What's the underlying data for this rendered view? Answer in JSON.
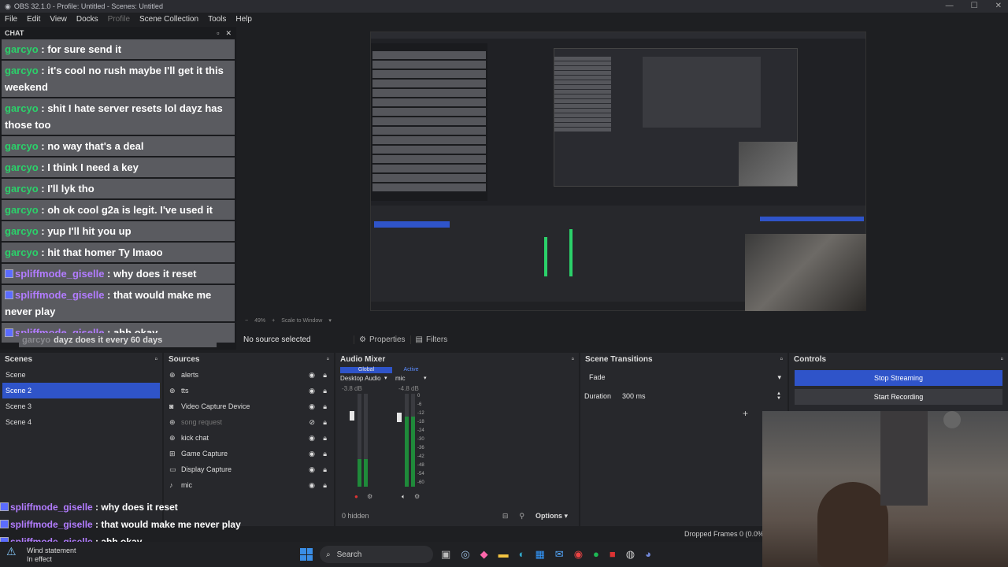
{
  "window": {
    "title": "OBS 32.1.0 - Profile: Untitled - Scenes: Untitled",
    "controls": [
      "—",
      "☐",
      "✕"
    ]
  },
  "menu": [
    "File",
    "Edit",
    "View",
    "Docks",
    "Profile",
    "Scene Collection",
    "Tools",
    "Help"
  ],
  "chat": {
    "title": "CHAT",
    "messages": [
      {
        "user": "garcyo",
        "text": "for sure send it",
        "badge": false
      },
      {
        "user": "garcyo",
        "text": "it's cool no rush maybe I'll get it this weekend",
        "badge": false
      },
      {
        "user": "garcyo",
        "text": "shit I hate server resets lol dayz has those too",
        "badge": false
      },
      {
        "user": "garcyo",
        "text": "no way that's a deal",
        "badge": false
      },
      {
        "user": "garcyo",
        "text": "I think I need a key",
        "badge": false
      },
      {
        "user": "garcyo",
        "text": "I'll lyk tho",
        "badge": false
      },
      {
        "user": "garcyo",
        "text": "oh ok cool g2a is legit. I've used it",
        "badge": false
      },
      {
        "user": "garcyo",
        "text": "yup I'll hit you up",
        "badge": false
      },
      {
        "user": "garcyo",
        "text": "hit that homer Ty lmaoo",
        "badge": false
      },
      {
        "user": "spliffmode_giselle",
        "text": "why does it reset",
        "badge": true
      },
      {
        "user": "spliffmode_giselle",
        "text": "that would make me never play",
        "badge": true
      },
      {
        "user": "spliffmode_giselle",
        "text": "ahh okay",
        "badge": true
      }
    ],
    "pending": {
      "user": "garcyo",
      "text": "dayz does it every 60 days"
    }
  },
  "preview": {
    "zoom": "49%",
    "zoom_label": "Scale to Window"
  },
  "source_bar": {
    "status": "No source selected",
    "properties": "Properties",
    "filters": "Filters"
  },
  "scenes": {
    "title": "Scenes",
    "items": [
      "Scene",
      "Scene 2",
      "Scene 3",
      "Scene 4"
    ],
    "selected": 1
  },
  "sources": {
    "title": "Sources",
    "items": [
      {
        "label": "alerts",
        "icon": "browser-icon",
        "visible": true
      },
      {
        "label": "tts",
        "icon": "browser-icon",
        "visible": true
      },
      {
        "label": "Video Capture Device",
        "icon": "camera-icon",
        "visible": true
      },
      {
        "label": "song request",
        "icon": "browser-icon",
        "visible": false
      },
      {
        "label": "kick chat",
        "icon": "browser-icon",
        "visible": true
      },
      {
        "label": "Game Capture",
        "icon": "gamepad-icon",
        "visible": true
      },
      {
        "label": "Display Capture",
        "icon": "monitor-icon",
        "visible": true
      },
      {
        "label": "mic",
        "icon": "mic-icon",
        "visible": true
      }
    ]
  },
  "mixer": {
    "title": "Audio Mixer",
    "tabs": [
      "Global",
      "Active"
    ],
    "channels": [
      {
        "name": "Desktop Audio",
        "db": "-3.8 dB",
        "level": 0.3
      },
      {
        "name": "mic",
        "db": "-4.8 dB",
        "level": 0.75
      }
    ],
    "ticks": [
      "0",
      "-6",
      "-12",
      "-18",
      "-24",
      "-30",
      "-36",
      "-42",
      "-48",
      "-54",
      "-60"
    ],
    "hidden": "0 hidden",
    "options": "Options"
  },
  "transitions": {
    "title": "Scene Transitions",
    "type": "Fade",
    "duration_label": "Duration",
    "duration": "300 ms"
  },
  "controls": {
    "title": "Controls",
    "stop_streaming": "Stop Streaming",
    "start_recording": "Start Recording"
  },
  "status": {
    "dropped": "Dropped Frames 0 (0.0%)"
  },
  "overlay_chat": [
    {
      "user": "spliffmode_giselle",
      "text": "why does it reset"
    },
    {
      "user": "spliffmode_giselle",
      "text": "that would make me never play"
    },
    {
      "user": "spliffmode_giselle",
      "text": "ahh okay"
    }
  ],
  "taskbar": {
    "weather_title": "Wind statement",
    "weather_sub": "In effect",
    "search": "Search",
    "colors": {
      "start": "#3a8ee6",
      "accent": "#2f54c9",
      "green_user": "#2bd16a",
      "purple_user": "#b27cff"
    }
  }
}
